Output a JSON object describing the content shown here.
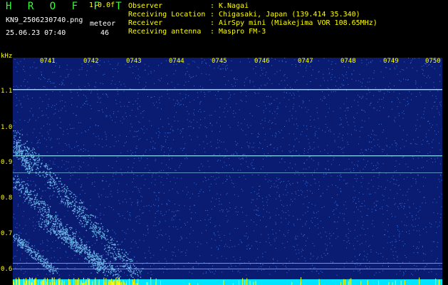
{
  "header": {
    "app_name": "H R O F F T",
    "version": "1.0.0f",
    "filename": "KN9_2506230740.png",
    "meteor_label": "meteor",
    "datetime": "25.06.23 07:40",
    "meteor_count": "46"
  },
  "info": [
    {
      "key": "Observer",
      "sep": ":",
      "value": "K.Nagai"
    },
    {
      "key": "Receiving Location",
      "sep": ":",
      "value": "Chigasaki, Japan (139.414 35.340)"
    },
    {
      "key": "Receiver",
      "sep": ":",
      "value": "AirSpy mini (Miakejima VOR 108.65MHz)"
    },
    {
      "key": "Receiving antenna",
      "sep": ":",
      "value": "Maspro FM-3"
    }
  ],
  "axis": {
    "unit": "kHz",
    "freq_ticks": [
      "1.1",
      "1.0",
      "0.9",
      "0.8",
      "0.7",
      "0.6"
    ],
    "time_ticks": [
      "0741",
      "0742",
      "0743",
      "0744",
      "0745",
      "0746",
      "0747",
      "0748",
      "0749",
      "0750"
    ]
  },
  "colors": {
    "background": "#0a1c72",
    "noise": "#4a8cff",
    "signal_line": "#9ff0ff",
    "baseline": "#00e5ff",
    "baseline_peaks": "#ffff00",
    "label_yellow": "#ffff00",
    "label_green": "#33ff33"
  }
}
